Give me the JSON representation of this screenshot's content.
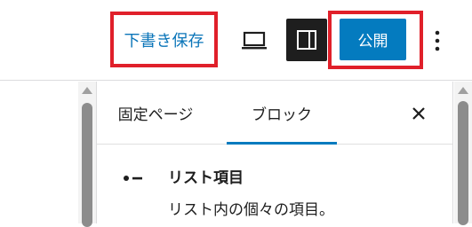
{
  "toolbar": {
    "save_draft_label": "下書き保存",
    "publish_label": "公開",
    "preview_icon": "laptop-icon",
    "settings_icon": "sidebar-panel-icon",
    "more_icon": "vertical-ellipsis-icon"
  },
  "sidebar": {
    "tabs": [
      {
        "label": "固定ページ",
        "active": false
      },
      {
        "label": "ブロック",
        "active": true
      }
    ],
    "close_icon": "close-icon",
    "block": {
      "icon": "list-item-icon",
      "title": "リスト項目",
      "description": "リスト内の個々の項目。"
    }
  },
  "colors": {
    "accent": "#047bbf",
    "highlight": "#e0202a",
    "settings_active_bg": "#1e1e1e"
  }
}
